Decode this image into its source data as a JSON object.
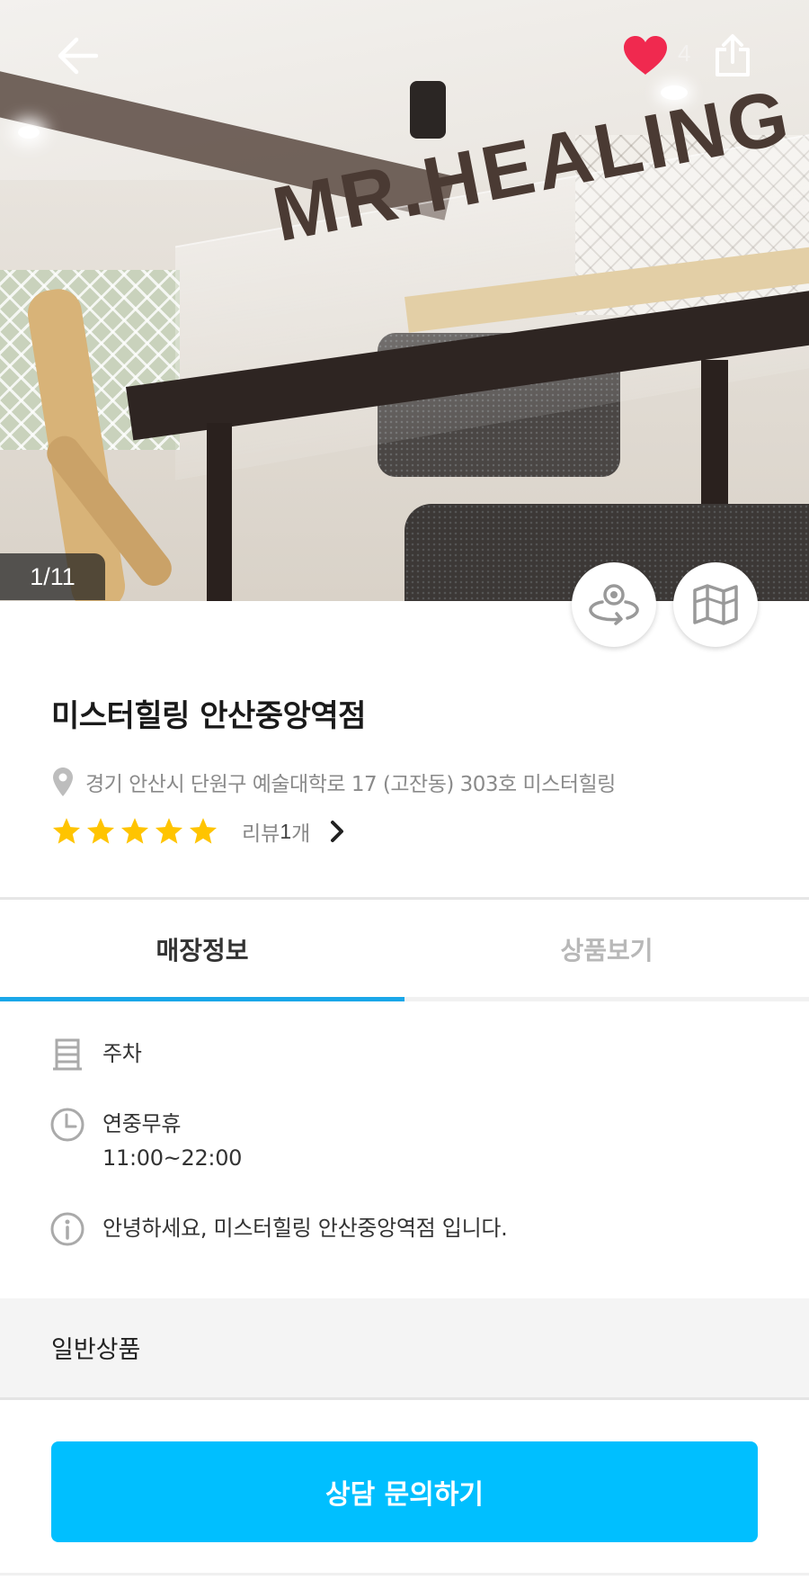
{
  "header": {
    "back_icon": "arrow-left-icon",
    "like_icon": "heart-icon",
    "like_count": "4",
    "share_icon": "share-icon",
    "like_color": "#F0294F"
  },
  "gallery": {
    "sign_text": "MR.HEALING",
    "counter": "1/11",
    "view360_icon": "360-view-icon",
    "map_icon": "map-icon"
  },
  "store": {
    "name": "미스터힐링 안산중앙역점",
    "address_icon": "location-pin-icon",
    "address": "경기 안산시 단원구 예술대학로 17 (고잔동) 303호 미스터힐링",
    "rating_stars": 5,
    "star_color": "#FFC400",
    "review_label": "리뷰",
    "review_count": "1",
    "review_unit": "개"
  },
  "tabs": [
    {
      "label": "매장정보",
      "active": true
    },
    {
      "label": "상품보기",
      "active": false
    }
  ],
  "accent_color": "#1AA7E8",
  "info": {
    "parking_icon": "parking-icon",
    "parking": "주차",
    "hours_icon": "clock-icon",
    "hours_days": "연중무휴",
    "hours_time": "11:00~22:00",
    "intro_icon": "info-icon",
    "intro": "안녕하세요, 미스터힐링 안산중앙역점 입니다."
  },
  "section": {
    "title": "일반상품"
  },
  "cta": {
    "label": "상담 문의하기",
    "color": "#00BFFF"
  }
}
